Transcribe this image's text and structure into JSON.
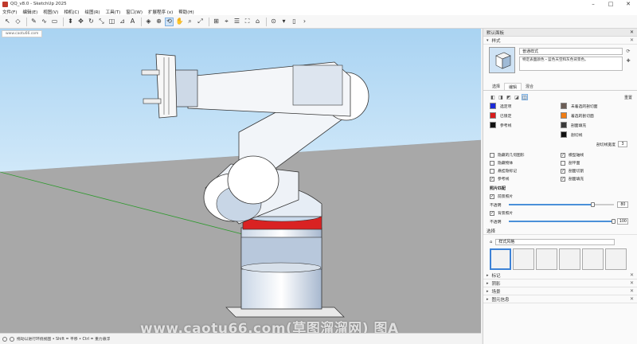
{
  "window": {
    "title": "QQ_v8.0 - SketchUp 2025"
  },
  "menu": [
    "文件(F)",
    "编辑(E)",
    "视图(V)",
    "相机(C)",
    "绘图(R)",
    "工具(T)",
    "窗口(W)",
    "扩展程序 (x)",
    "帮助(H)"
  ],
  "toolbar": {
    "icons": [
      "select-arrow",
      "eraser",
      "line",
      "freehand",
      "rectangle",
      "circle",
      "push-pull",
      "move",
      "rotate",
      "scale",
      "offset",
      "tape",
      "text",
      "paint",
      "orbit",
      "pan",
      "zoom",
      "zoom-extents",
      "previous",
      "section",
      "x-ray",
      "layers",
      "components",
      "3d-warehouse",
      "extension",
      "geo"
    ]
  },
  "viewport": {
    "tab": "www.caotu66.com",
    "watermark": "www.caotu66.com(草图溜溜网) 图A"
  },
  "status": {
    "text": "拖动以进行环绕视图 • Shift = 平移 • Ctrl = 重力悬浮"
  },
  "panel": {
    "title": "默认面板",
    "style_section": "样式",
    "style_name": "普通样式",
    "style_desc": "特定表面颜色・蓝色天空和灰色背景色。",
    "tabs": [
      "选择",
      "编辑",
      "混合"
    ],
    "active_tab": 1,
    "reset_label": "重置",
    "colors": [
      {
        "label": "选定项",
        "color": "#1a2ad8"
      },
      {
        "label": "未着选的剖切面",
        "color": "#6b5d55"
      },
      {
        "label": "已锁定",
        "color": "#d81b1b"
      },
      {
        "label": "着选的剖切面",
        "color": "#f07d14"
      },
      {
        "label": "参考线",
        "color": "#111111"
      },
      {
        "label": "剖面填充",
        "color": "#3a3a3a"
      },
      {
        "label": "",
        "color": ""
      },
      {
        "label": "剖切线",
        "color": "#111111"
      }
    ],
    "width_label": "剖切线宽度",
    "width_value": "3",
    "checks": [
      {
        "label": "隐藏的几何图形",
        "checked": false
      },
      {
        "label": "模型轴线",
        "checked": true
      },
      {
        "label": "隐藏物体",
        "checked": false
      },
      {
        "label": "剖平面",
        "checked": false
      },
      {
        "label": "悬挂隐标记",
        "checked": false
      },
      {
        "label": "剖面切割",
        "checked": true
      },
      {
        "label": "参考线",
        "checked": true
      },
      {
        "label": "剖面填充",
        "checked": true
      }
    ],
    "photo_header": "照片匹配",
    "fg_label": "前景照片",
    "fg_checked": true,
    "opacity_label": "不透明",
    "fg_value": 80,
    "bg_label": "背景照片",
    "bg_checked": true,
    "bg_value": 100,
    "select_section": "选择",
    "select_dropdown": "样式风格",
    "collapsed": [
      "标记",
      "阴影",
      "场景",
      "图元信息"
    ]
  }
}
